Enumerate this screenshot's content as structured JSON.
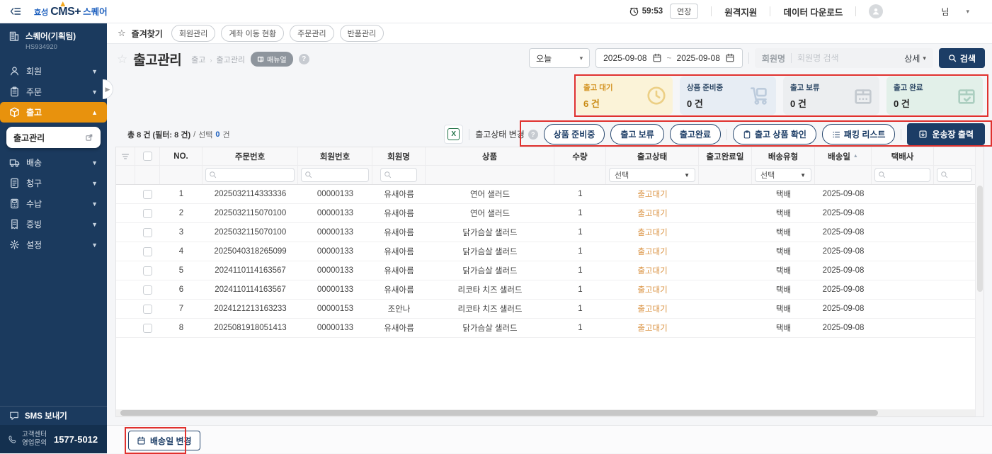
{
  "header": {
    "logo_prefix": "효성",
    "logo_brand": "CMS+",
    "logo_suffix": "스퀘어",
    "timer": "59:53",
    "extend_button": "연장",
    "remote_support": "원격지원",
    "data_download": "데이터 다운로드",
    "user_suffix": "님"
  },
  "sidebar": {
    "org_name": "스퀘어(기획팀)",
    "org_code": "HS934920",
    "menu": [
      {
        "label": "회원"
      },
      {
        "label": "주문"
      },
      {
        "label": "출고"
      },
      {
        "label": "배송"
      },
      {
        "label": "청구"
      },
      {
        "label": "수납"
      },
      {
        "label": "증빙"
      },
      {
        "label": "설정"
      }
    ],
    "submenu_label": "출고관리",
    "sms_label": "SMS 보내기",
    "contact_line1": "고객센터",
    "contact_line2": "영업문의",
    "contact_phone": "1577-5012"
  },
  "favorites": {
    "label": "즐겨찾기",
    "tabs": [
      "회원관리",
      "계좌 이동 현황",
      "주문관리",
      "반품관리"
    ]
  },
  "page": {
    "title": "출고관리",
    "breadcrumb_parent": "출고",
    "breadcrumb_current": "출고관리",
    "manual_badge": "매뉴얼",
    "help": "?"
  },
  "filters": {
    "preset": "오늘",
    "date_from": "2025-09-08",
    "date_to": "2025-09-08",
    "member_label": "회원명",
    "member_placeholder": "회원명 검색",
    "detail_label": "상세",
    "search_button": "검색"
  },
  "status_cards": [
    {
      "label": "출고 대기",
      "count": "6 건"
    },
    {
      "label": "상품 준비중",
      "count": "0 건"
    },
    {
      "label": "출고 보류",
      "count": "0 건"
    },
    {
      "label": "출고 완료",
      "count": "0 건"
    }
  ],
  "list_summary": {
    "total_text": "총 8 건 (필터: 8 건)",
    "separator": "/",
    "selected_prefix": "선택",
    "selected_count": "0",
    "selected_unit": "건"
  },
  "toolbar": {
    "status_change_label": "출고상태 변경",
    "help": "?",
    "prepare_button": "상품 준비중",
    "hold_button": "출고 보류",
    "complete_button": "출고완료",
    "check_product_button": "출고 상품 확인",
    "packing_list_button": "패킹 리스트",
    "print_invoice_button": "운송장 출력"
  },
  "table": {
    "columns": {
      "no": "NO.",
      "order_no": "주문번호",
      "member_no": "회원번호",
      "member_name": "회원명",
      "product": "상품",
      "qty": "수량",
      "status": "출고상태",
      "complete_date": "출고완료일",
      "delivery_type": "배송유형",
      "delivery_date": "배송일",
      "courier": "택배사"
    },
    "select_placeholder": "선택",
    "rows": [
      {
        "no": "1",
        "order_no": "2025032114333336",
        "member_no": "00000133",
        "member_name": "유새아름",
        "product": "연어 샐러드",
        "qty": "1",
        "status": "출고대기",
        "complete_date": "",
        "delivery_type": "택배",
        "delivery_date": "2025-09-08",
        "courier": ""
      },
      {
        "no": "2",
        "order_no": "2025032115070100",
        "member_no": "00000133",
        "member_name": "유새아름",
        "product": "연어 샐러드",
        "qty": "1",
        "status": "출고대기",
        "complete_date": "",
        "delivery_type": "택배",
        "delivery_date": "2025-09-08",
        "courier": ""
      },
      {
        "no": "3",
        "order_no": "2025032115070100",
        "member_no": "00000133",
        "member_name": "유새아름",
        "product": "닭가슴살 샐러드",
        "qty": "1",
        "status": "출고대기",
        "complete_date": "",
        "delivery_type": "택배",
        "delivery_date": "2025-09-08",
        "courier": ""
      },
      {
        "no": "4",
        "order_no": "2025040318265099",
        "member_no": "00000133",
        "member_name": "유새아름",
        "product": "닭가슴살 샐러드",
        "qty": "1",
        "status": "출고대기",
        "complete_date": "",
        "delivery_type": "택배",
        "delivery_date": "2025-09-08",
        "courier": ""
      },
      {
        "no": "5",
        "order_no": "2024110114163567",
        "member_no": "00000133",
        "member_name": "유새아름",
        "product": "닭가슴살 샐러드",
        "qty": "1",
        "status": "출고대기",
        "complete_date": "",
        "delivery_type": "택배",
        "delivery_date": "2025-09-08",
        "courier": ""
      },
      {
        "no": "6",
        "order_no": "2024110114163567",
        "member_no": "00000133",
        "member_name": "유새아름",
        "product": "리코타 치즈 샐러드",
        "qty": "1",
        "status": "출고대기",
        "complete_date": "",
        "delivery_type": "택배",
        "delivery_date": "2025-09-08",
        "courier": ""
      },
      {
        "no": "7",
        "order_no": "2024121213163233",
        "member_no": "00000153",
        "member_name": "조안나",
        "product": "리코타 치즈 샐러드",
        "qty": "1",
        "status": "출고대기",
        "complete_date": "",
        "delivery_type": "택배",
        "delivery_date": "2025-09-08",
        "courier": ""
      },
      {
        "no": "8",
        "order_no": "2025081918051413",
        "member_no": "00000133",
        "member_name": "유새아름",
        "product": "닭가슴살 샐러드",
        "qty": "1",
        "status": "출고대기",
        "complete_date": "",
        "delivery_type": "택배",
        "delivery_date": "2025-09-08",
        "courier": ""
      }
    ]
  },
  "footer": {
    "change_delivery_date_button": "배송일 변경"
  }
}
